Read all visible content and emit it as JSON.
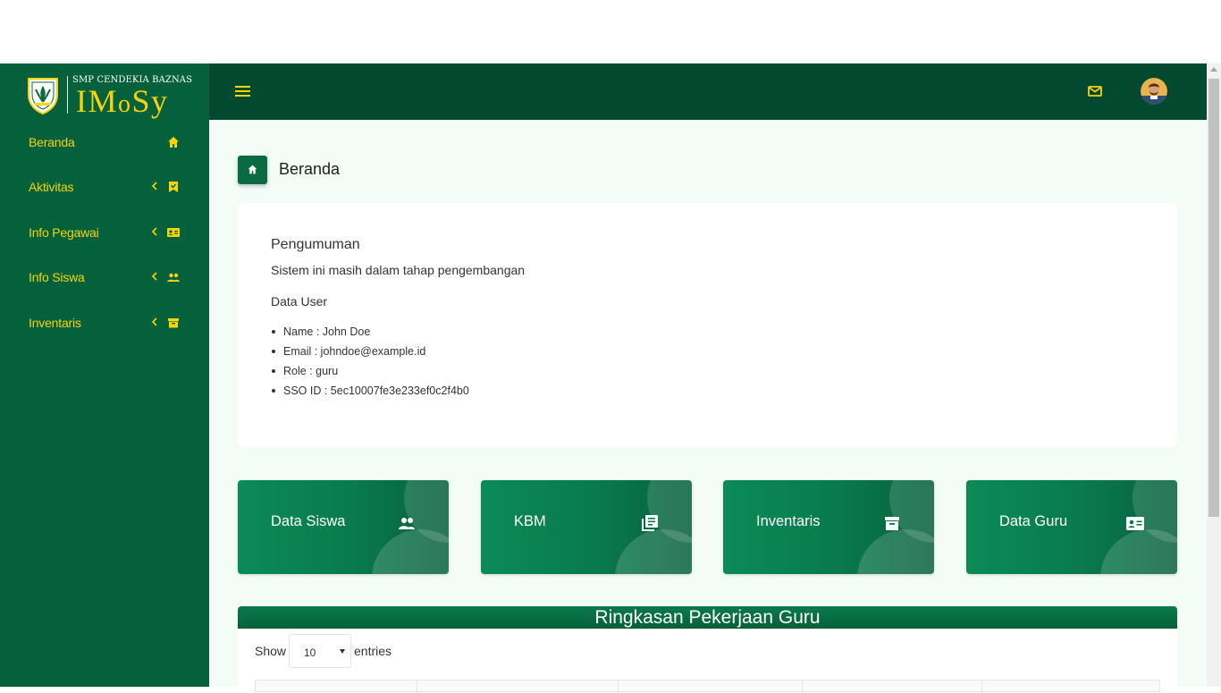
{
  "brand": {
    "school": "SMP CENDEKIA BAZNAS",
    "app_name_big": "IM",
    "app_name_small_o": "o",
    "app_name_tail": "Sy",
    "colors": {
      "sidebar": "#05613c",
      "header": "#03492f",
      "accent": "#f6d40c",
      "main_bg": "#f3fcf6"
    }
  },
  "sidebar": {
    "items": [
      {
        "label": "Beranda",
        "icon": "home-icon",
        "has_submenu": false
      },
      {
        "label": "Aktivitas",
        "icon": "bookmark-check-icon",
        "has_submenu": true
      },
      {
        "label": "Info Pegawai",
        "icon": "id-card-icon",
        "has_submenu": true
      },
      {
        "label": "Info Siswa",
        "icon": "people-icon",
        "has_submenu": true
      },
      {
        "label": "Inventaris",
        "icon": "archive-box-icon",
        "has_submenu": true
      }
    ]
  },
  "header": {
    "menu_icon": "hamburger-menu-icon",
    "mail_icon": "mail-icon",
    "avatar": "user-avatar"
  },
  "page": {
    "title": "Beranda",
    "title_icon": "home-icon"
  },
  "announcement": {
    "title": "Pengumuman",
    "message": "Sistem ini masih dalam tahap pengembangan",
    "user_heading": "Data User",
    "user_details": [
      "Name : John Doe",
      "Email : johndoe@example.id",
      "Role : guru",
      "SSO ID : 5ec10007fe3e233ef0c2f4b0"
    ]
  },
  "cards": [
    {
      "label": "Data Siswa",
      "icon": "people-icon"
    },
    {
      "label": "KBM",
      "icon": "library-books-icon"
    },
    {
      "label": "Inventaris",
      "icon": "archive-box-icon"
    },
    {
      "label": "Data Guru",
      "icon": "id-card-icon"
    }
  ],
  "summary": {
    "title": "Ringkasan Pekerjaan Guru",
    "show_label": "Show",
    "page_size": "10",
    "entries_label": "entries"
  }
}
